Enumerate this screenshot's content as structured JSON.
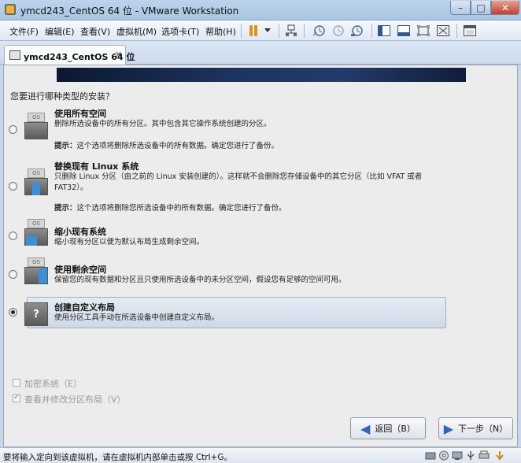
{
  "window": {
    "title": "ymcd243_CentOS 64 位 - VMware Workstation",
    "min_glyph": "–",
    "max_glyph": "□",
    "close_glyph": "✕"
  },
  "menu": {
    "items": [
      "文件(F)",
      "编辑(E)",
      "查看(V)",
      "虚拟机(M)",
      "选项卡(T)",
      "帮助(H)"
    ]
  },
  "tab": {
    "label": "ymcd243_CentOS 64 位",
    "close_glyph": "✕"
  },
  "installer": {
    "question": "您要进行哪种类型的安装？",
    "disk_label": "OS",
    "options": [
      {
        "title": "使用所有空间",
        "desc": "删除所选设备中的所有分区。其中包含其它操作系统创建的分区。",
        "tip_label": "提示：",
        "tip": "这个选项将删除所选设备中的所有数据。确定您进行了备份。",
        "selected": false
      },
      {
        "title": "替换现有 Linux 系统",
        "desc": "只删除 Linux 分区（由之前的 Linux 安装创建的）。这样就不会删除您存储设备中的其它分区（比如 VFAT 或者 FAT32）。",
        "tip_label": "提示：",
        "tip": "这个选项将删除您所选设备中的所有数据。确定您进行了备份。",
        "selected": false
      },
      {
        "title": "缩小现有系统",
        "desc": "缩小现有分区以便为默认布局生成剩余空间。",
        "selected": false
      },
      {
        "title": "使用剩余空间",
        "desc": "保留您的现有数据和分区且只使用所选设备中的未分区空间，假设您有足够的空间可用。",
        "selected": false
      },
      {
        "title": "创建自定义布局",
        "desc": "使用分区工具手动在所选设备中创建自定义布局。",
        "selected": true
      }
    ],
    "encrypt_label": "加密系统（E）",
    "encrypt_checked": false,
    "review_label": "查看并修改分区布局（V）",
    "review_checked": true,
    "back_label": "返回（B）",
    "next_label": "下一步（N）"
  },
  "status": {
    "text": "要将输入定向到该虚拟机，请在虚拟机内部单击或按 Ctrl+G。"
  },
  "colors": {
    "accent": "#2f67b6",
    "pause": "#e09018",
    "close_button": "#c4412b"
  }
}
